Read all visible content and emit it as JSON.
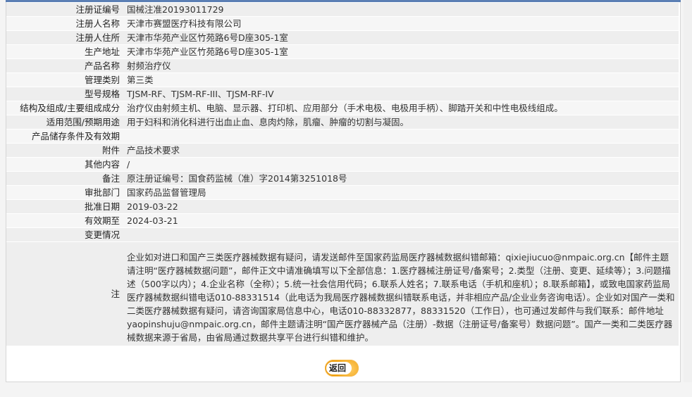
{
  "rows": [
    {
      "label": "注册证编号",
      "value": "国械注准20193011729"
    },
    {
      "label": "注册人名称",
      "value": "天津市赛盟医疗科技有限公司"
    },
    {
      "label": "注册人住所",
      "value": "天津市华苑产业区竹苑路6号D座305-1室"
    },
    {
      "label": "生产地址",
      "value": "天津市华苑产业区竹苑路6号D座305-1室"
    },
    {
      "label": "产品名称",
      "value": "射频治疗仪"
    },
    {
      "label": "管理类别",
      "value": "第三类"
    },
    {
      "label": "型号规格",
      "value": "TJSM-RF、TJSM-RF-III、TJSM-RF-IV"
    },
    {
      "label": "结构及组成/主要组成成分",
      "value": "治疗仪由射频主机、电脑、显示器、打印机、应用部分（手术电极、电极用手柄）、脚踏开关和中性电极线组成。"
    },
    {
      "label": "适用范围/预期用途",
      "value": "用于妇科和消化科进行出血止血、息肉灼除，肌瘤、肿瘤的切割与凝固。"
    },
    {
      "label": "产品储存条件及有效期",
      "value": ""
    },
    {
      "label": "附件",
      "value": "产品技术要求"
    },
    {
      "label": "其他内容",
      "value": "/"
    },
    {
      "label": "备注",
      "value": "原注册证编号：国食药监械（准）字2014第3251018号"
    },
    {
      "label": "审批部门",
      "value": "国家药品监督管理局"
    },
    {
      "label": "批准日期",
      "value": "2019-03-22"
    },
    {
      "label": "有效期至",
      "value": "2024-03-21"
    },
    {
      "label": "变更情况",
      "value": ""
    }
  ],
  "note": {
    "label": "注",
    "text": "企业如对进口和国产三类医疗器械数据有疑问，请发送邮件至国家药监局医疗器械数据纠错邮箱：qixiejiucuo@nmpaic.org.cn【邮件主题请注明“医疗器械数据问题”，邮件正文中请准确填写以下全部信息：1.医疗器械注册证号/备案号；2.类型（注册、变更、延续等）；3.问题描述（500字以内）；4.企业名称（全称）；5.统一社会信用代码；6.联系人姓名；7.联系电话（手机和座机）；8.联系邮箱】，或致电国家药监局医疗器械数据纠错电话010-88331514（此电话为我局医疗器械数据纠错联系电话，并非相应产品/企业业务咨询电话）。企业如对国产一类和二类医疗器械数据有疑问，请咨询国家局信息中心，电话010-88332877，88331520（工作日），也可通过发邮件与我们联系：邮件地址yaopinshuju@nmpaic.org.cn，邮件主题请注明“国产医疗器械产品（注册）-数据（注册证号/备案号）数据问题”。国产一类和二类医疗器械数据来源于省局，由省局通过数据共享平台进行纠错和维护。"
  },
  "back_button": {
    "label": "返回"
  },
  "colors": {
    "label_bg": "#eeeeee",
    "alt_bg": "#f6f6f6",
    "top_bar": "#5b7fb4",
    "button_orange": "#f0a20f"
  }
}
